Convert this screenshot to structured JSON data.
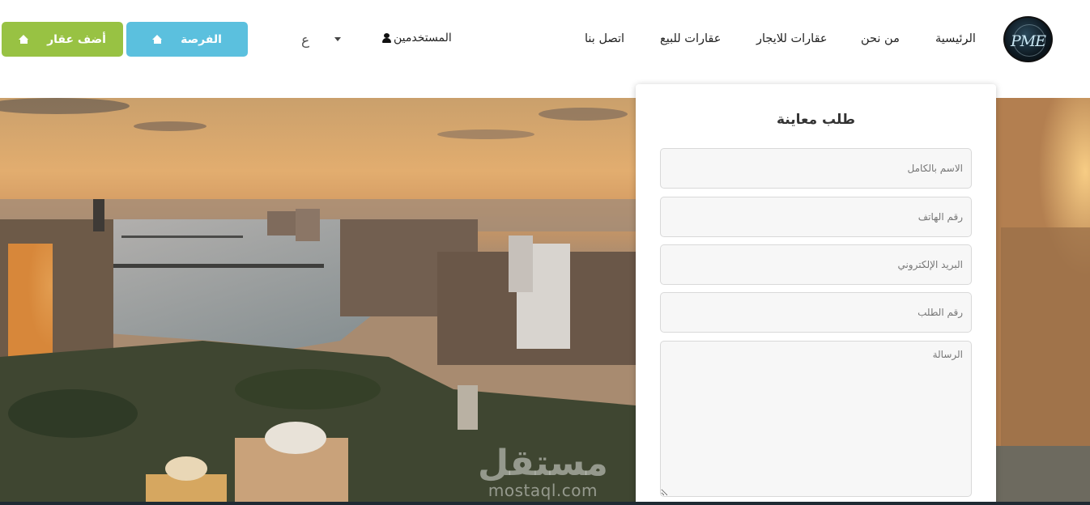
{
  "brand": {
    "logo_text": "PME"
  },
  "nav": {
    "home": "الرئيسية",
    "about": "من نحن",
    "rent": "عقارات للايجار",
    "sale": "عقارات للبيع",
    "contact": "اتصل بنا"
  },
  "users": {
    "label": "المستخدمين"
  },
  "language": {
    "label": "ع"
  },
  "buttons": {
    "opportunity": "الفرصة",
    "add_property": "أضف عقار"
  },
  "form": {
    "title": "طلب معاينة",
    "full_name_placeholder": "الاسم بالكامل",
    "phone_placeholder": "رقم الهاتف",
    "email_placeholder": "البريد الإلكتروني",
    "order_number_placeholder": "رقم الطلب",
    "message_placeholder": "الرسالة"
  },
  "watermark": {
    "arabic": "مستقل",
    "url": "mostaql.com"
  },
  "colors": {
    "opportunity_button": "#5bc0de",
    "add_button": "#98c243",
    "field_background": "#f7f7f7"
  },
  "icons": [
    "user-icon",
    "home-icon",
    "caret-down-icon"
  ]
}
